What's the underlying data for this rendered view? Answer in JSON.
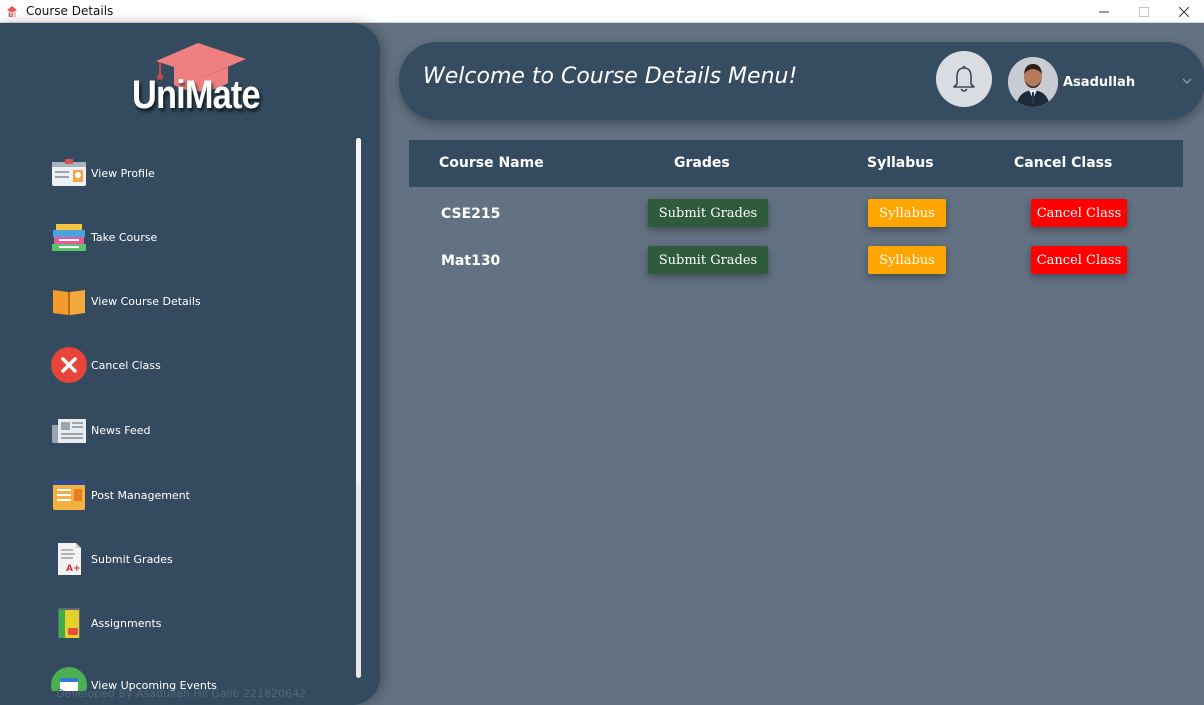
{
  "window": {
    "title": "Course Details",
    "minimize_icon": "minimize-icon",
    "maximize_icon": "maximize-icon",
    "close_icon": "close-icon"
  },
  "sidebar": {
    "logo_text": "UniMate",
    "items": [
      {
        "label": "View Profile",
        "icon": "id-card-icon"
      },
      {
        "label": "Take Course",
        "icon": "books-icon"
      },
      {
        "label": "View Course Details",
        "icon": "open-book-icon"
      },
      {
        "label": "Cancel Class",
        "icon": "cancel-circle-icon"
      },
      {
        "label": "News Feed",
        "icon": "newspaper-icon"
      },
      {
        "label": "Post Management",
        "icon": "post-icon"
      },
      {
        "label": "Submit Grades",
        "icon": "grade-document-icon"
      },
      {
        "label": "Assignments",
        "icon": "assignment-icon"
      },
      {
        "label": "View Upcoming Events",
        "icon": "calendar-icon"
      }
    ],
    "footer": "Developed By Asadullah Hil Galib 221820642"
  },
  "header": {
    "welcome": "Welcome to Course Details Menu!",
    "user_name": "Asadullah",
    "bell_icon": "bell-icon",
    "caret_icon": "chevron-down-icon"
  },
  "table": {
    "columns": [
      "Course Name",
      "Grades",
      "Syllabus",
      "Cancel Class"
    ],
    "rows": [
      {
        "course": "CSE215",
        "grades_label": "Submit Grades",
        "syllabus_label": "Syllabus",
        "cancel_label": "Cancel Class"
      },
      {
        "course": "Mat130",
        "grades_label": "Submit Grades",
        "syllabus_label": "Syllabus",
        "cancel_label": "Cancel Class"
      }
    ]
  },
  "colors": {
    "sidebar": "#344b5f",
    "content": "#627282",
    "grades_button": "#2f5a3c",
    "syllabus_button": "#ffa500",
    "cancel_button": "#ff0000"
  }
}
